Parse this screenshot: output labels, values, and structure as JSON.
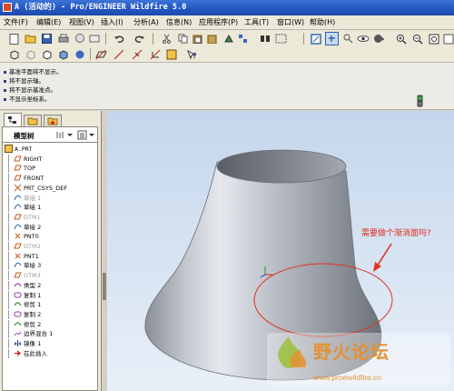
{
  "window": {
    "title": "A (活动的) - Pro/ENGINEER Wildfire 5.0"
  },
  "menu": [
    "文件(F)",
    "编辑(E)",
    "视图(V)",
    "插入(I)",
    "分析(A)",
    "信息(N)",
    "应用程序(P)",
    "工具(T)",
    "窗口(W)",
    "帮助(H)"
  ],
  "messages": [
    "基准平面将不显示。",
    "将不显示轴。",
    "将不显示基准点。",
    "不显示坐标系。"
  ],
  "model_tree": {
    "title": "模型树",
    "rows": [
      {
        "label": "A.PRT",
        "icon": "part-icon",
        "dim": false
      },
      {
        "label": "RIGHT",
        "icon": "datum-plane-icon",
        "dim": false
      },
      {
        "label": "TOP",
        "icon": "datum-plane-icon",
        "dim": false
      },
      {
        "label": "FRONT",
        "icon": "datum-plane-icon",
        "dim": false
      },
      {
        "label": "PRT_CSYS_DEF",
        "icon": "csys-icon",
        "dim": false
      },
      {
        "label": "草绘 1",
        "icon": "sketch-icon",
        "dim": true
      },
      {
        "label": "草绘 1",
        "icon": "sketch-icon",
        "dim": false
      },
      {
        "label": "DTM1",
        "icon": "datum-plane-icon",
        "dim": true
      },
      {
        "label": "草绘 2",
        "icon": "sketch-icon",
        "dim": false
      },
      {
        "label": "PNT0",
        "icon": "datum-point-icon",
        "dim": false
      },
      {
        "label": "DTM2",
        "icon": "datum-plane-icon",
        "dim": true
      },
      {
        "label": "PNT1",
        "icon": "datum-point-icon",
        "dim": false
      },
      {
        "label": "草绘 3",
        "icon": "sketch-icon",
        "dim": false
      },
      {
        "label": "DTM3",
        "icon": "datum-plane-icon",
        "dim": true
      },
      {
        "label": "类型 2",
        "icon": "surface-icon",
        "dim": false
      },
      {
        "label": "复制 1",
        "icon": "copy-icon",
        "dim": false
      },
      {
        "label": "修剪 1",
        "icon": "trim-icon",
        "dim": false
      },
      {
        "label": "复制 2",
        "icon": "copy-icon",
        "dim": false
      },
      {
        "label": "修剪 2",
        "icon": "trim-icon",
        "dim": false
      },
      {
        "label": "边界混合 1",
        "icon": "boundary-blend-icon",
        "dim": false
      },
      {
        "label": "镜像 1",
        "icon": "mirror-icon",
        "dim": false
      },
      {
        "label": "在此插入",
        "icon": "insert-here-icon",
        "dim": false
      }
    ]
  },
  "annotation": {
    "text": "需要做个渐消面吗?"
  },
  "watermark": {
    "title": "野火论坛",
    "url": "www.proewildfire.cn"
  },
  "colors": {
    "titlebar": "#2457c2",
    "annotation": "#e0301e",
    "watermark": "#e58f2a",
    "viewport_bg": "#d6e3f2"
  }
}
